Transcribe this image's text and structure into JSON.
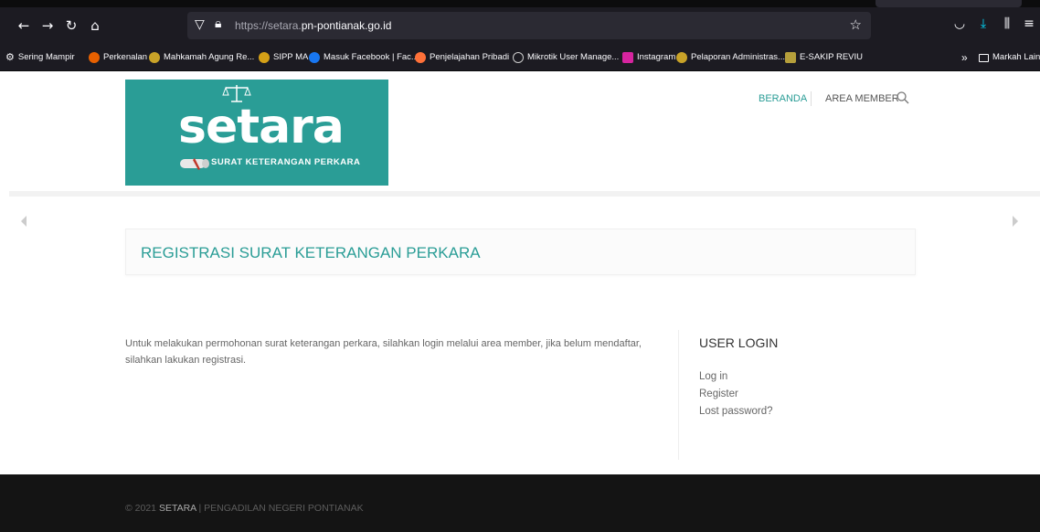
{
  "browser": {
    "url_prefix": "https://setara.",
    "url_domain": "pn-pontianak.go.id",
    "nav": {
      "back": "←",
      "forward": "→",
      "reload": "↻",
      "home": "⌂"
    },
    "bookmarks": [
      {
        "label": "Sering Mampir",
        "color": "#fbfbfe"
      },
      {
        "label": "Perkenalan",
        "color": "#e66000"
      },
      {
        "label": "Mahkamah Agung Re...",
        "color": "#c8a228"
      },
      {
        "label": "SIPP MA",
        "color": "#d4a017"
      },
      {
        "label": "Masuk Facebook | Fac...",
        "color": "#1877f2"
      },
      {
        "label": "Penjelajahan Pribadi",
        "color": "#ff7139"
      },
      {
        "label": "Mikrotik User Manage...",
        "color": "#cccccc"
      },
      {
        "label": "Instagram",
        "color": "#d6249f"
      },
      {
        "label": "Pelaporan Administras...",
        "color": "#c8a228"
      },
      {
        "label": "E-SAKIP REVIU",
        "color": "#b59f3b"
      }
    ],
    "overflow": "»",
    "other_bookmarks": "Markah Lain"
  },
  "site": {
    "logo_word": "setara",
    "logo_sub": "SURAT KETERANGAN PERKARA",
    "nav": {
      "home": "BERANDA",
      "member": "AREA MEMBER"
    },
    "page_title": "REGISTRASI SURAT KETERANGAN PERKARA",
    "body_text": "Untuk melakukan permohonan surat keterangan perkara, silahkan login melalui area member, jika belum mendaftar, silahkan lakukan registrasi.",
    "sidebar": {
      "title": "USER LOGIN",
      "links": [
        "Log in",
        "Register",
        "Lost password?"
      ]
    },
    "footer": {
      "prefix": "© 2021 ",
      "brand": "SETARA",
      "suffix": " | PENGADILAN NEGERI PONTIANAK"
    }
  },
  "colors": {
    "accent": "#2a9d96",
    "footer_bg": "#141414",
    "chrome_bg": "#1c1b22"
  }
}
